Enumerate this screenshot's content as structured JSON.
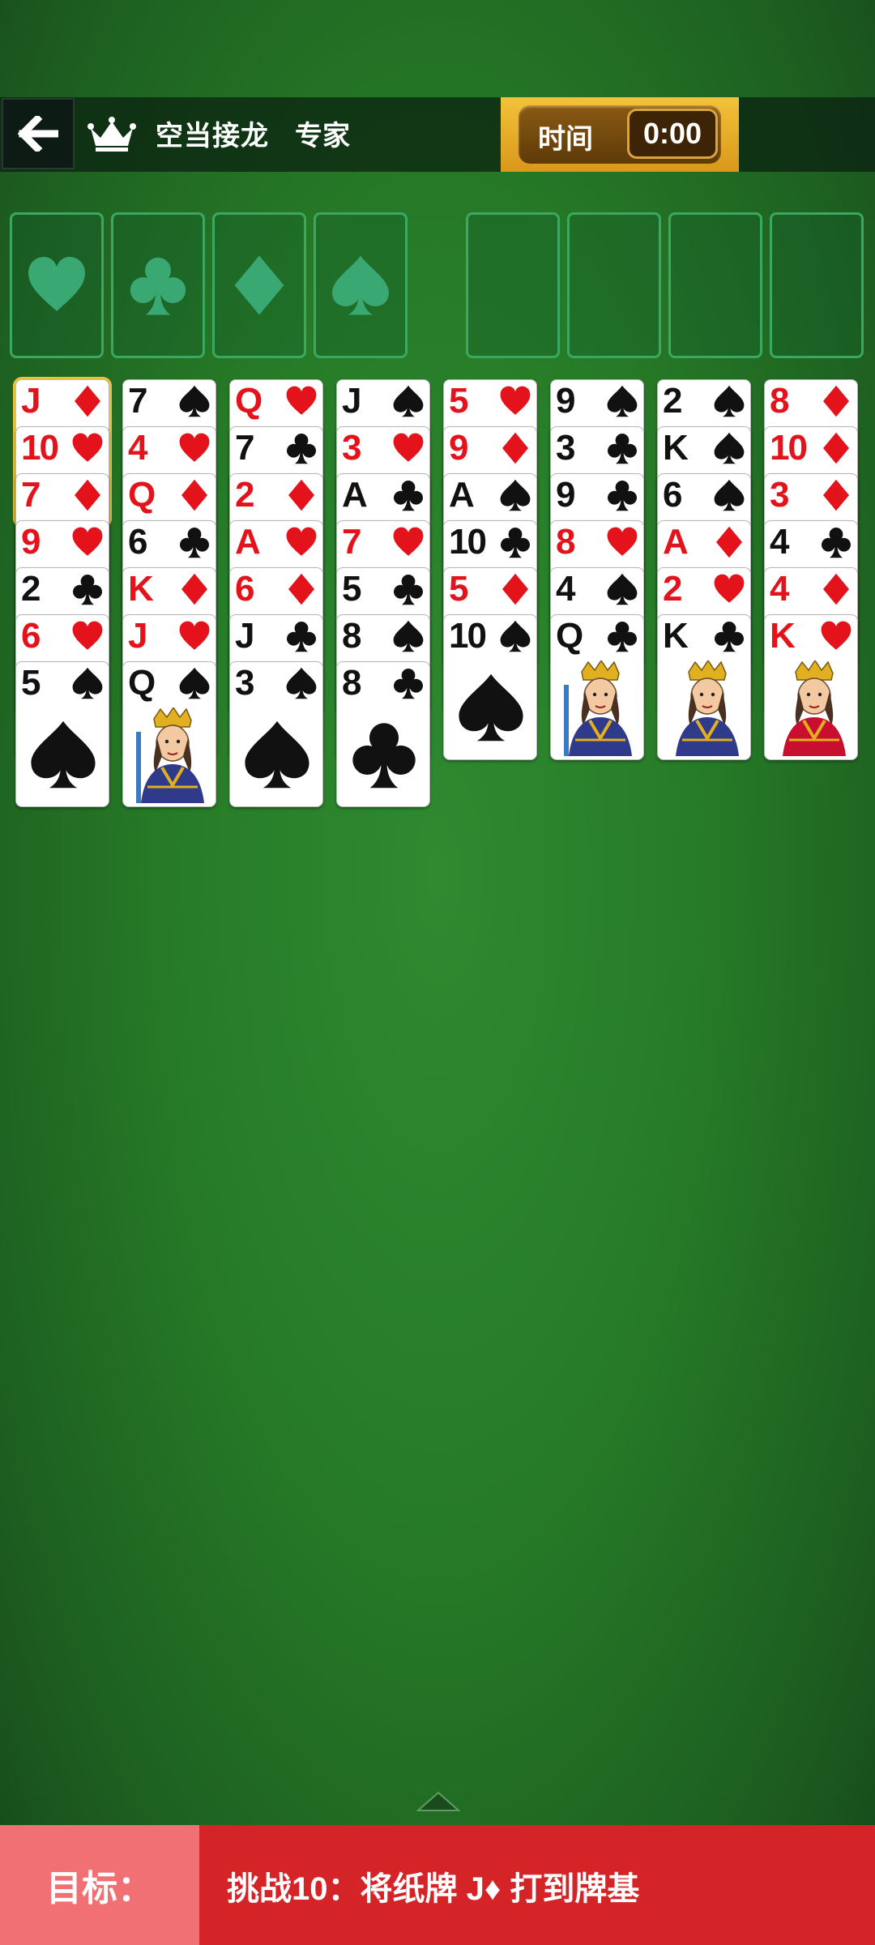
{
  "header": {
    "back_icon": "arrow-left-icon",
    "crown_icon": "crown-icon",
    "title": "空当接龙",
    "mode": "专家",
    "timer_label": "时间",
    "timer_value": "0:00"
  },
  "foundations": [
    {
      "suit": "heart"
    },
    {
      "suit": "club"
    },
    {
      "suit": "diamond"
    },
    {
      "suit": "spade"
    }
  ],
  "free_cells": [
    {},
    {},
    {},
    {}
  ],
  "columns": [
    [
      {
        "rank": "J",
        "suit": "diamond",
        "selected": true
      },
      {
        "rank": "10",
        "suit": "heart"
      },
      {
        "rank": "7",
        "suit": "diamond"
      },
      {
        "rank": "9",
        "suit": "heart"
      },
      {
        "rank": "2",
        "suit": "club"
      },
      {
        "rank": "6",
        "suit": "heart"
      },
      {
        "rank": "5",
        "suit": "spade"
      }
    ],
    [
      {
        "rank": "7",
        "suit": "spade"
      },
      {
        "rank": "4",
        "suit": "heart"
      },
      {
        "rank": "Q",
        "suit": "diamond"
      },
      {
        "rank": "6",
        "suit": "club"
      },
      {
        "rank": "K",
        "suit": "diamond"
      },
      {
        "rank": "J",
        "suit": "heart"
      },
      {
        "rank": "Q",
        "suit": "spade"
      }
    ],
    [
      {
        "rank": "Q",
        "suit": "heart"
      },
      {
        "rank": "7",
        "suit": "club"
      },
      {
        "rank": "2",
        "suit": "diamond"
      },
      {
        "rank": "A",
        "suit": "heart"
      },
      {
        "rank": "6",
        "suit": "diamond"
      },
      {
        "rank": "J",
        "suit": "club"
      },
      {
        "rank": "3",
        "suit": "spade"
      }
    ],
    [
      {
        "rank": "J",
        "suit": "spade"
      },
      {
        "rank": "3",
        "suit": "heart"
      },
      {
        "rank": "A",
        "suit": "club"
      },
      {
        "rank": "7",
        "suit": "heart"
      },
      {
        "rank": "5",
        "suit": "club"
      },
      {
        "rank": "8",
        "suit": "spade"
      },
      {
        "rank": "8",
        "suit": "club"
      }
    ],
    [
      {
        "rank": "5",
        "suit": "heart"
      },
      {
        "rank": "9",
        "suit": "diamond"
      },
      {
        "rank": "A",
        "suit": "spade"
      },
      {
        "rank": "10",
        "suit": "club"
      },
      {
        "rank": "5",
        "suit": "diamond"
      },
      {
        "rank": "10",
        "suit": "spade"
      }
    ],
    [
      {
        "rank": "9",
        "suit": "spade"
      },
      {
        "rank": "3",
        "suit": "club"
      },
      {
        "rank": "9",
        "suit": "club"
      },
      {
        "rank": "8",
        "suit": "heart"
      },
      {
        "rank": "4",
        "suit": "spade"
      },
      {
        "rank": "Q",
        "suit": "club"
      }
    ],
    [
      {
        "rank": "2",
        "suit": "spade"
      },
      {
        "rank": "K",
        "suit": "spade"
      },
      {
        "rank": "6",
        "suit": "spade"
      },
      {
        "rank": "A",
        "suit": "diamond"
      },
      {
        "rank": "2",
        "suit": "heart"
      },
      {
        "rank": "K",
        "suit": "club"
      }
    ],
    [
      {
        "rank": "8",
        "suit": "diamond"
      },
      {
        "rank": "10",
        "suit": "diamond"
      },
      {
        "rank": "3",
        "suit": "diamond"
      },
      {
        "rank": "4",
        "suit": "club"
      },
      {
        "rank": "4",
        "suit": "diamond"
      },
      {
        "rank": "K",
        "suit": "heart"
      }
    ]
  ],
  "bottom": {
    "expand_icon": "chevron-up-icon",
    "goal_label": "目标：",
    "goal_text": "挑战10：将纸牌 J♦ 打到牌基"
  }
}
